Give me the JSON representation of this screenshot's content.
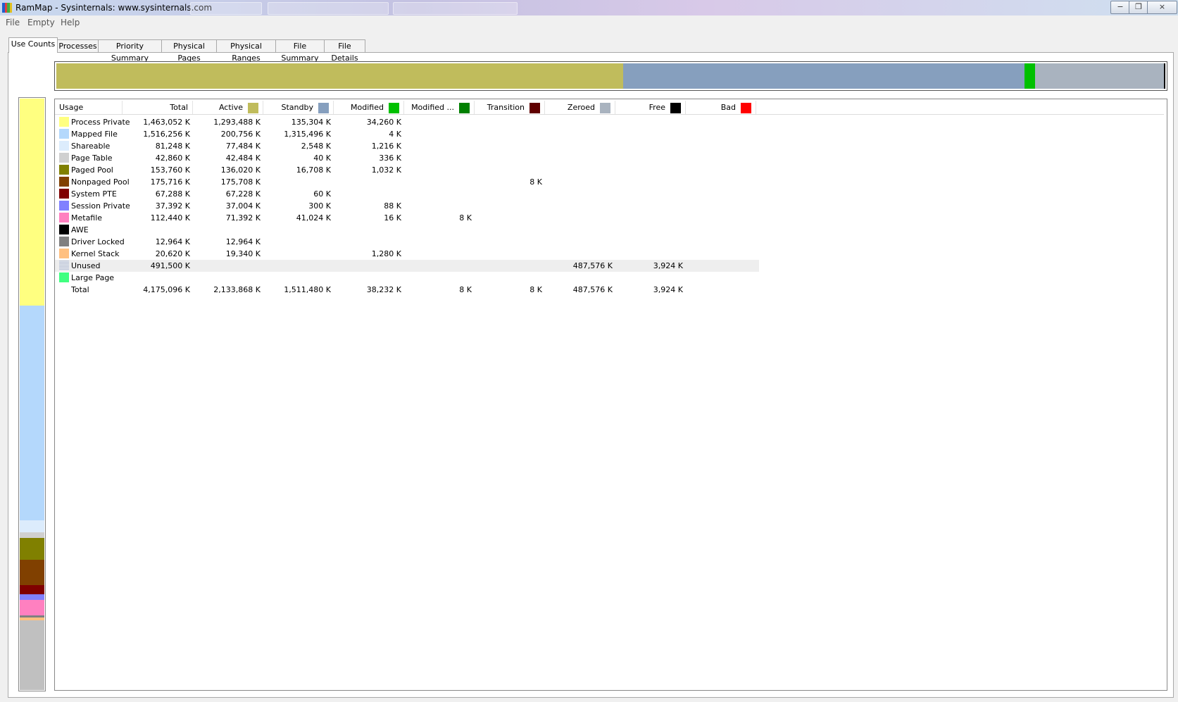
{
  "window": {
    "title": "RamMap - Sysinternals: www.sysinternals.com",
    "minimize_glyph": "−",
    "maximize_glyph": "❐",
    "close_glyph": "×"
  },
  "menu": {
    "items": [
      "File",
      "Empty",
      "Help"
    ]
  },
  "tabs": [
    "Use Counts",
    "Processes",
    "Priority Summary",
    "Physical Pages",
    "Physical Ranges",
    "File Summary",
    "File Details"
  ],
  "active_tab": "Use Counts",
  "columns": [
    {
      "label": "Usage",
      "color": null
    },
    {
      "label": "Total",
      "color": null
    },
    {
      "label": "Active",
      "color": "#c0bc5c"
    },
    {
      "label": "Standby",
      "color": "#869fbe"
    },
    {
      "label": "Modified",
      "color": "#00c000"
    },
    {
      "label": "Modified ...",
      "color": "#008000"
    },
    {
      "label": "Transition",
      "color": "#600000"
    },
    {
      "label": "Zeroed",
      "color": "#a9b3bf"
    },
    {
      "label": "Free",
      "color": "#000000"
    },
    {
      "label": "Bad",
      "color": "#ff0000"
    }
  ],
  "rows": [
    {
      "usage": "Process Private",
      "color": "#ffff80",
      "total": "1,463,052 K",
      "active": "1,293,488 K",
      "standby": "135,304 K",
      "modified": "34,260 K",
      "modified_nowrite": "",
      "transition": "",
      "zeroed": "",
      "free": "",
      "bad": ""
    },
    {
      "usage": "Mapped File",
      "color": "#b4d8fc",
      "total": "1,516,256 K",
      "active": "200,756 K",
      "standby": "1,315,496 K",
      "modified": "4 K",
      "modified_nowrite": "",
      "transition": "",
      "zeroed": "",
      "free": "",
      "bad": ""
    },
    {
      "usage": "Shareable",
      "color": "#dcecfc",
      "total": "81,248 K",
      "active": "77,484 K",
      "standby": "2,548 K",
      "modified": "1,216 K",
      "modified_nowrite": "",
      "transition": "",
      "zeroed": "",
      "free": "",
      "bad": ""
    },
    {
      "usage": "Page Table",
      "color": "#d0d0d0",
      "total": "42,860 K",
      "active": "42,484 K",
      "standby": "40 K",
      "modified": "336 K",
      "modified_nowrite": "",
      "transition": "",
      "zeroed": "",
      "free": "",
      "bad": ""
    },
    {
      "usage": "Paged Pool",
      "color": "#808000",
      "total": "153,760 K",
      "active": "136,020 K",
      "standby": "16,708 K",
      "modified": "1,032 K",
      "modified_nowrite": "",
      "transition": "",
      "zeroed": "",
      "free": "",
      "bad": ""
    },
    {
      "usage": "Nonpaged Pool",
      "color": "#804000",
      "total": "175,716 K",
      "active": "175,708 K",
      "standby": "",
      "modified": "",
      "modified_nowrite": "",
      "transition": "8 K",
      "zeroed": "",
      "free": "",
      "bad": ""
    },
    {
      "usage": "System PTE",
      "color": "#800000",
      "total": "67,288 K",
      "active": "67,228 K",
      "standby": "60 K",
      "modified": "",
      "modified_nowrite": "",
      "transition": "",
      "zeroed": "",
      "free": "",
      "bad": ""
    },
    {
      "usage": "Session Private",
      "color": "#8080ff",
      "total": "37,392 K",
      "active": "37,004 K",
      "standby": "300 K",
      "modified": "88 K",
      "modified_nowrite": "",
      "transition": "",
      "zeroed": "",
      "free": "",
      "bad": ""
    },
    {
      "usage": "Metafile",
      "color": "#ff80c0",
      "total": "112,440 K",
      "active": "71,392 K",
      "standby": "41,024 K",
      "modified": "16 K",
      "modified_nowrite": "8 K",
      "transition": "",
      "zeroed": "",
      "free": "",
      "bad": ""
    },
    {
      "usage": "AWE",
      "color": "#000000",
      "total": "",
      "active": "",
      "standby": "",
      "modified": "",
      "modified_nowrite": "",
      "transition": "",
      "zeroed": "",
      "free": "",
      "bad": ""
    },
    {
      "usage": "Driver Locked",
      "color": "#808080",
      "total": "12,964 K",
      "active": "12,964 K",
      "standby": "",
      "modified": "",
      "modified_nowrite": "",
      "transition": "",
      "zeroed": "",
      "free": "",
      "bad": ""
    },
    {
      "usage": "Kernel Stack",
      "color": "#ffc080",
      "total": "20,620 K",
      "active": "19,340 K",
      "standby": "",
      "modified": "1,280 K",
      "modified_nowrite": "",
      "transition": "",
      "zeroed": "",
      "free": "",
      "bad": ""
    },
    {
      "usage": "Unused",
      "color": "#c0c8d8",
      "total": "491,500 K",
      "active": "",
      "standby": "",
      "modified": "",
      "modified_nowrite": "",
      "transition": "",
      "zeroed": "487,576 K",
      "free": "3,924 K",
      "bad": "",
      "selected": true
    },
    {
      "usage": "Large Page",
      "color": "#40ff80",
      "total": "",
      "active": "",
      "standby": "",
      "modified": "",
      "modified_nowrite": "",
      "transition": "",
      "zeroed": "",
      "free": "",
      "bad": ""
    },
    {
      "usage": "Total",
      "color": null,
      "total": "4,175,096 K",
      "active": "2,133,868 K",
      "standby": "1,511,480 K",
      "modified": "38,232 K",
      "modified_nowrite": "8 K",
      "transition": "8 K",
      "zeroed": "487,576 K",
      "free": "3,924 K",
      "bad": ""
    }
  ],
  "state_bar": [
    {
      "state": "Active",
      "value_k": 2133868,
      "color": "#c0bc5c"
    },
    {
      "state": "Standby",
      "value_k": 1511480,
      "color": "#869fbe"
    },
    {
      "state": "Modified",
      "value_k": 38232,
      "color": "#00c000"
    },
    {
      "state": "Modified no write",
      "value_k": 8,
      "color": "#008000"
    },
    {
      "state": "Transition",
      "value_k": 8,
      "color": "#600000"
    },
    {
      "state": "Zeroed",
      "value_k": 487576,
      "color": "#a9b3bf"
    },
    {
      "state": "Free",
      "value_k": 3924,
      "color": "#000000"
    }
  ],
  "usage_bar": [
    {
      "usage": "Process Private",
      "value_k": 1463052,
      "color": "#ffff80"
    },
    {
      "usage": "Mapped File",
      "value_k": 1516256,
      "color": "#b4d8fc"
    },
    {
      "usage": "Shareable",
      "value_k": 81248,
      "color": "#dcecfc"
    },
    {
      "usage": "Page Table",
      "value_k": 42860,
      "color": "#d0d0d0"
    },
    {
      "usage": "Paged Pool",
      "value_k": 153760,
      "color": "#808000"
    },
    {
      "usage": "Nonpaged Pool",
      "value_k": 175716,
      "color": "#804000"
    },
    {
      "usage": "System PTE",
      "value_k": 67288,
      "color": "#800000"
    },
    {
      "usage": "Session Private",
      "value_k": 37392,
      "color": "#8080ff"
    },
    {
      "usage": "Metafile",
      "value_k": 112440,
      "color": "#ff80c0"
    },
    {
      "usage": "Driver Locked",
      "value_k": 12964,
      "color": "#808080"
    },
    {
      "usage": "Kernel Stack",
      "value_k": 20620,
      "color": "#ffc080"
    },
    {
      "usage": "Unused",
      "value_k": 491500,
      "color": "#c0c0c0"
    }
  ]
}
